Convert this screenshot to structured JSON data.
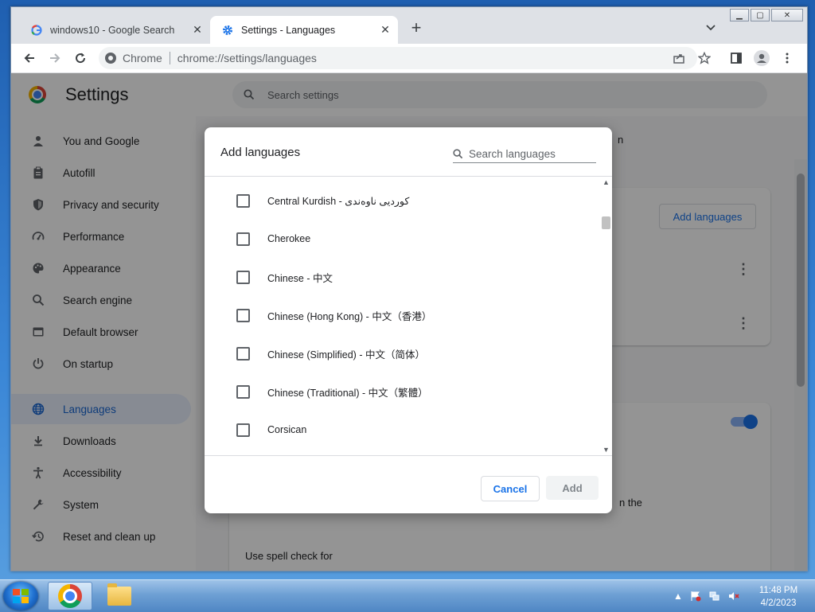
{
  "browser": {
    "tabs": [
      {
        "title": "windows10 - Google Search",
        "favicon": "google-g-icon"
      },
      {
        "title": "Settings - Languages",
        "favicon": "settings-gear-icon"
      }
    ],
    "omnibox": {
      "chip": "Chrome",
      "url": "chrome://settings/languages"
    }
  },
  "settings": {
    "title": "Settings",
    "search_placeholder": "Search settings",
    "sidebar": [
      {
        "label": "You and Google",
        "icon": "person-icon"
      },
      {
        "label": "Autofill",
        "icon": "clipboard-icon"
      },
      {
        "label": "Privacy and security",
        "icon": "shield-icon"
      },
      {
        "label": "Performance",
        "icon": "gauge-icon"
      },
      {
        "label": "Appearance",
        "icon": "palette-icon"
      },
      {
        "label": "Search engine",
        "icon": "search-icon"
      },
      {
        "label": "Default browser",
        "icon": "browser-window-icon"
      },
      {
        "label": "On startup",
        "icon": "power-icon"
      },
      {
        "label": "Languages",
        "icon": "globe-icon",
        "active": true
      },
      {
        "label": "Downloads",
        "icon": "download-icon"
      },
      {
        "label": "Accessibility",
        "icon": "accessibility-icon"
      },
      {
        "label": "System",
        "icon": "wrench-icon"
      },
      {
        "label": "Reset and clean up",
        "icon": "history-icon"
      }
    ],
    "add_languages_button": "Add languages",
    "spell_check_label": "Use spell check for",
    "bg_fragment_n": "n",
    "bg_fragment_the": "n the"
  },
  "dialog": {
    "title": "Add languages",
    "search_placeholder": "Search languages",
    "languages": [
      {
        "label": "Central Kurdish - کوردیی ناوەندی",
        "checked": false
      },
      {
        "label": "Cherokee",
        "checked": false
      },
      {
        "label": "Chinese - 中文",
        "checked": false
      },
      {
        "label": "Chinese (Hong Kong) - 中文（香港）",
        "checked": false
      },
      {
        "label": "Chinese (Simplified) - 中文（简体）",
        "checked": false
      },
      {
        "label": "Chinese (Traditional) - 中文（繁體）",
        "checked": false
      },
      {
        "label": "Corsican",
        "checked": false
      }
    ],
    "cancel_label": "Cancel",
    "add_label": "Add"
  },
  "taskbar": {
    "time": "11:48 PM",
    "date": "4/2/2023"
  },
  "colors": {
    "accent": "#1a73e8",
    "active_nav_bg": "#e8f0fe"
  }
}
